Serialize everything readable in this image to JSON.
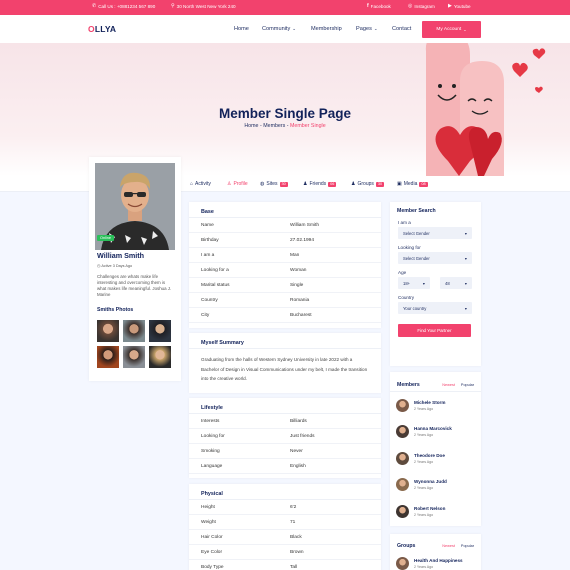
{
  "topbar": {
    "phone": "Call Us : +0881234 567 890",
    "address": "30 North West New York 240",
    "facebook": "Facebook",
    "instagram": "Instagram",
    "youtube": "Youtube"
  },
  "nav": {
    "logo_o": "O",
    "logo_rest": "LLYA",
    "home": "Home",
    "community": "Community",
    "membership": "Membership",
    "pages": "Pages",
    "contact": "Contact",
    "account": "My Account"
  },
  "hero": {
    "title": "Member Single Page",
    "crumb_home": "Home",
    "crumb_sep1": " - ",
    "crumb_members": "Members",
    "crumb_sep2": " - ",
    "crumb_current": "Member Single"
  },
  "tabs": {
    "activity": "Activity",
    "profile": "Profile",
    "sites": "Sites",
    "sites_count": "30",
    "friends": "Friends",
    "friends_count": "06",
    "groups": "Groups",
    "groups_count": "30",
    "media": "Media",
    "media_count": "08"
  },
  "profile": {
    "status": "Online",
    "name": "William Smith",
    "active": "Active 3 Days Ago",
    "bio": "Challenges are whats make life interesting and overcoming them is what makes life meaningful. Joshua J. Marine",
    "photos_title": "Smiths Photos"
  },
  "base": {
    "title": "Base",
    "rows": [
      [
        "Name",
        "William Smith"
      ],
      [
        "Birthday",
        "27.02.1994"
      ],
      [
        "I am a",
        "Man"
      ],
      [
        "Looking for a",
        "Woman"
      ],
      [
        "Marital status",
        "Single"
      ],
      [
        "Country",
        "Romania"
      ],
      [
        "City",
        "Bucharest"
      ]
    ]
  },
  "summary": {
    "title": "Myself Summary",
    "text": "Graduating from the halls of Western Sydney University in late 2022 with a Bachelor of Design in Visual Communications under my belt, I made the transition into the creative world."
  },
  "lifestyle": {
    "title": "Lifestyle",
    "rows": [
      [
        "Interests",
        "Billiards"
      ],
      [
        "Looking for",
        "Just friends"
      ],
      [
        "Smoking",
        "Never"
      ],
      [
        "Language",
        "English"
      ]
    ]
  },
  "physical": {
    "title": "Physical",
    "rows": [
      [
        "Height",
        "6'2"
      ],
      [
        "Weight",
        "71"
      ],
      [
        "Hair Color",
        "Black"
      ],
      [
        "Eye Color",
        "Brown"
      ],
      [
        "Body Type",
        "Tall"
      ]
    ]
  },
  "search": {
    "title": "Member Search",
    "iam_label": "I am a",
    "iam_value": "Select Gender",
    "looking_label": "Looking for",
    "looking_value": "Select Gender",
    "age_label": "Age",
    "age_from": "18+",
    "age_to": "48",
    "country_label": "Country",
    "country_value": "Your country",
    "button": "Find Your Partner"
  },
  "members": {
    "title": "Members",
    "newest": "Newest",
    "popular": "Popular",
    "list": [
      {
        "name": "Michele Storm",
        "time": "2 Years Ago"
      },
      {
        "name": "Hanna Marcovick",
        "time": "2 Years Ago"
      },
      {
        "name": "Theodore Doe",
        "time": "2 Years Ago"
      },
      {
        "name": "Wynonna Judd",
        "time": "2 Years Ago"
      },
      {
        "name": "Robert Nelson",
        "time": "2 Years Ago"
      }
    ]
  },
  "groups": {
    "title": "Groups",
    "newest": "Newest",
    "popular": "Popular",
    "list": [
      {
        "name": "Health And Happiness",
        "time": "2 Years Ago"
      }
    ]
  },
  "colors": {
    "accent": "#f2426d",
    "navy": "#12225a",
    "online": "#2bbf5a"
  }
}
